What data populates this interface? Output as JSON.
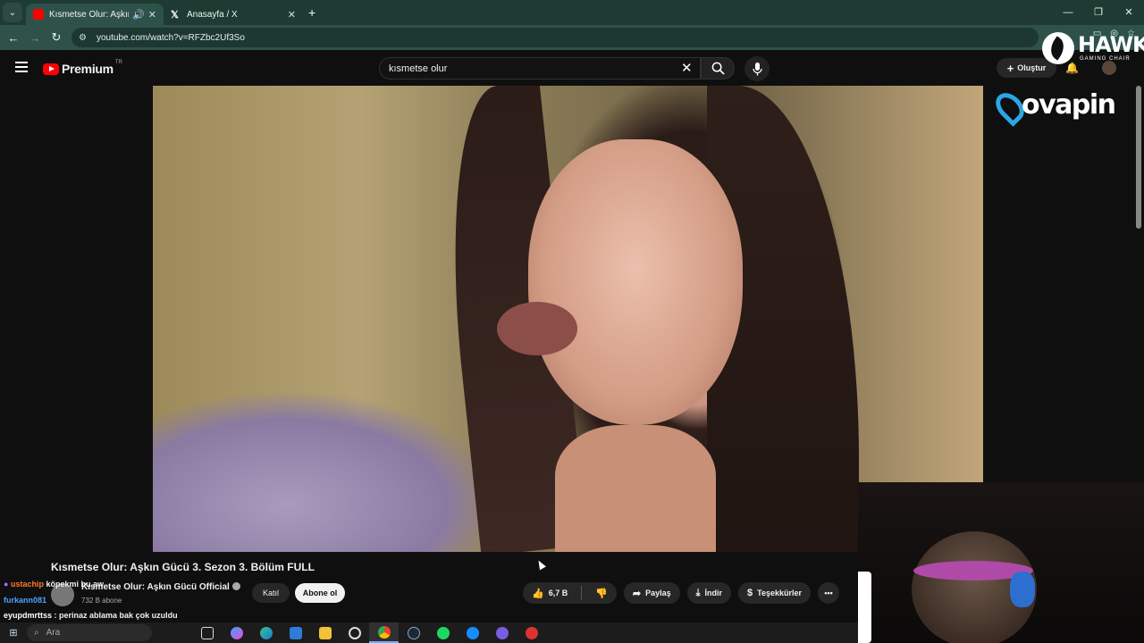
{
  "browser": {
    "tabs": [
      {
        "label": "Kısmetse Olur: Aşkın Gücü",
        "icon": "youtube-icon",
        "active": true
      },
      {
        "label": "Anasayfa / X",
        "icon": "x-logo-icon",
        "active": false
      }
    ],
    "url": "youtube.com/watch?v=RFZbc2Uf3So",
    "colors": {
      "frame": "#1f3a33",
      "toolbar": "#2e5249"
    }
  },
  "youtube": {
    "brand": "Premium",
    "country": "TR",
    "search_query": "kısmetse olur",
    "create_label": "Oluştur",
    "video_title": "Kısmetse Olur: Aşkın Gücü 3. Sezon 3. Bölüm FULL",
    "channel_name": "Kısmetse Olur: Aşkın Gücü Official",
    "subscribers": "732 B abone",
    "join_label": "Katıl",
    "subscribe_label": "Abone ol",
    "likes": "6,7 B",
    "share_label": "Paylaş",
    "download_label": "İndir",
    "thanks_label": "Teşekkürler"
  },
  "overlay": {
    "sponsor_hawk": {
      "name": "HAWK",
      "tagline": "GAMING CHAIR"
    },
    "sponsor_vpn": "ovapin",
    "chat": [
      {
        "user": "ustachip",
        "text": "köpekmi bu aw",
        "color": "#ff7a2a"
      },
      {
        "user": "furkann081",
        "text": "",
        "color": "#4aa3ff"
      },
      {
        "user": "eyupdmrttss",
        "text": ": perinaz ablama bak çok uzuldu",
        "color": "#ffffff"
      }
    ]
  },
  "taskbar": {
    "search_placeholder": "Ara",
    "apps": [
      "task-view-icon",
      "copilot-icon",
      "edge-icon",
      "mail-icon",
      "file-explorer-icon",
      "xbox-icon",
      "chrome-icon",
      "steam-icon",
      "spotify-icon",
      "battlenet-icon",
      "discord-icon",
      "game-app-icon"
    ]
  }
}
